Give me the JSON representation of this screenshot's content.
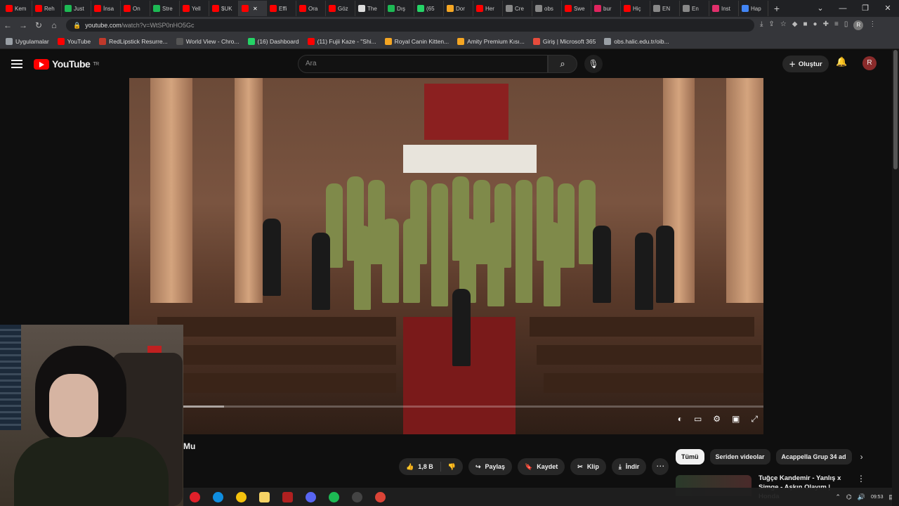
{
  "browser": {
    "tabs": [
      "Kem",
      "Reh",
      "Just",
      "İnsa",
      "On",
      "Stre",
      "Yell",
      "$UK",
      "",
      "Effi",
      "Ora",
      "Göz",
      "The",
      "Dış",
      "(65",
      "Dor",
      "Her",
      "Cre",
      "obs",
      "Swe",
      "bur",
      "Hiç",
      "EN",
      "En",
      "Inst",
      "Hap"
    ],
    "tab_colors": [
      "#ff0000",
      "#ff0000",
      "#1db954",
      "#ff0000",
      "#ff0000",
      "#1db954",
      "#ff0000",
      "#ff0000",
      "#ff0000",
      "#ff0000",
      "#ff0000",
      "#ff0000",
      "#dddddd",
      "#1db954",
      "#25d366",
      "#f5a623",
      "#ff0000",
      "#888888",
      "#888888",
      "#ff0000",
      "#e0245e",
      "#ff0000",
      "#888888",
      "#888888",
      "#e1306c",
      "#4285f4"
    ],
    "url_domain": "youtube.com",
    "url_path": "/watch?v=WtSP0nHO5Gc",
    "window_controls": [
      "⌄",
      "—",
      "❐",
      "✕"
    ],
    "bookmarks": [
      {
        "label": "Uygulamalar",
        "color": "#9aa0a6"
      },
      {
        "label": "YouTube",
        "color": "#ff0000"
      },
      {
        "label": "RedLipstick Resurre...",
        "color": "#c0392b"
      },
      {
        "label": "World View - Chro...",
        "color": "#555555"
      },
      {
        "label": "(16) Dashboard",
        "color": "#25d366"
      },
      {
        "label": "(11) Fujii Kaze - \"Shi...",
        "color": "#ff0000"
      },
      {
        "label": "Royal Canin Kitten...",
        "color": "#f5a623"
      },
      {
        "label": "Amity Premium Kısı...",
        "color": "#f5a623"
      },
      {
        "label": "Giriş | Microsoft 365",
        "color": "#e74c3c"
      },
      {
        "label": "obs.halic.edu.tr/oib...",
        "color": "#9aa0a6"
      }
    ]
  },
  "youtube": {
    "logo_text": "YouTube",
    "logo_sup": "TR",
    "search_placeholder": "Ara",
    "create_label": "Oluştur",
    "avatar_letter": "R",
    "accent": "#ff0000"
  },
  "video": {
    "title_fragment": "Mu",
    "progress_played": 0.07,
    "progress_loaded": 0.15,
    "likes": "1,8 B",
    "actions": {
      "share": "Paylaş",
      "save": "Kaydet",
      "clip": "Klip",
      "download": "İndir"
    }
  },
  "chips": [
    "Tümü",
    "Seriden videolar",
    "Acappella Grup 34 ad"
  ],
  "recommendation": {
    "title": "Tuğçe Kandemir - Yanlış x Simge - Aşkın Olayım | Honda"
  },
  "taskbar": {
    "apps": [
      {
        "name": "opera",
        "color": "#e0202a"
      },
      {
        "name": "edge",
        "color": "#0f8ee0"
      },
      {
        "name": "chrome",
        "color": "#f4c20d"
      },
      {
        "name": "files",
        "color": "#f6d365"
      },
      {
        "name": "winrar",
        "color": "#b02020"
      },
      {
        "name": "discord",
        "color": "#5865f2"
      },
      {
        "name": "spotify",
        "color": "#1db954"
      },
      {
        "name": "obs",
        "color": "#444444"
      },
      {
        "name": "chrome-alt",
        "color": "#db4437"
      }
    ],
    "time": "09:53"
  }
}
